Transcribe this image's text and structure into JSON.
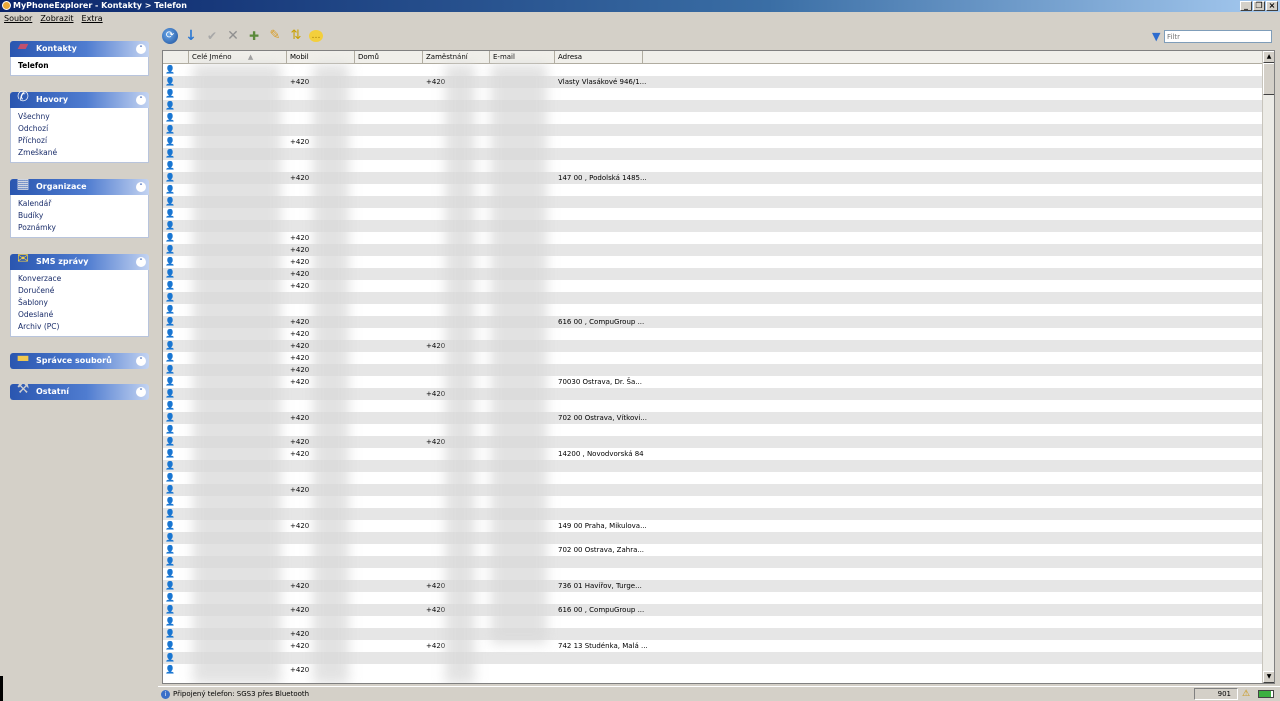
{
  "window": {
    "title": "MyPhoneExplorer -  Kontakty > Telefon",
    "buttons": [
      "_",
      "❐",
      "×"
    ]
  },
  "menu": [
    "Soubor",
    "Zobrazit",
    "Extra"
  ],
  "filter": {
    "placeholder": "Filtr"
  },
  "sidebar": {
    "groups": [
      {
        "title": "Kontakty",
        "icon": "contacts-book-icon",
        "items": [
          "Telefon"
        ]
      },
      {
        "title": "Hovory",
        "icon": "phone-calls-icon",
        "items": [
          "Všechny",
          "Odchozí",
          "Příchozí",
          "Zmeškané"
        ]
      },
      {
        "title": "Organizace",
        "icon": "organizer-icon",
        "items": [
          "Kalendář",
          "Budíky",
          "Poznámky"
        ]
      },
      {
        "title": "SMS zprávy",
        "icon": "sms-envelope-icon",
        "items": [
          "Konverzace",
          "Doručené",
          "Šablony",
          "Odeslané",
          "Archiv (PC)"
        ]
      },
      {
        "title": "Správce souborů",
        "icon": "folder-icon",
        "items": []
      },
      {
        "title": "Ostatní",
        "icon": "tools-icon",
        "items": []
      }
    ]
  },
  "grid": {
    "columns": [
      "Celé Jméno",
      "Mobil",
      "Domů",
      "Zaměstnání",
      "E-mail",
      "Adresa"
    ],
    "rows": [
      [
        "",
        "",
        "",
        "",
        "",
        ""
      ],
      [
        "",
        "+420",
        "",
        "+420",
        "",
        "Vlasty Vlasákové 946/1..."
      ],
      [
        "",
        "",
        "",
        "",
        "",
        ""
      ],
      [
        "",
        "",
        "",
        "",
        "",
        ""
      ],
      [
        "",
        "",
        "",
        "",
        "",
        ""
      ],
      [
        "",
        "",
        "",
        "",
        "",
        ""
      ],
      [
        "",
        "+420",
        "",
        "",
        "",
        ""
      ],
      [
        "",
        "",
        "",
        "",
        "",
        ""
      ],
      [
        "",
        "",
        "",
        "",
        "",
        ""
      ],
      [
        "",
        "+420",
        "",
        "",
        "",
        "147 00 , Podolská 1485..."
      ],
      [
        "",
        "",
        "",
        "",
        "",
        ""
      ],
      [
        "",
        "",
        "",
        "",
        "",
        ""
      ],
      [
        "",
        "",
        "",
        "",
        "",
        ""
      ],
      [
        "",
        "",
        "",
        "",
        "",
        ""
      ],
      [
        "",
        "+420",
        "",
        "",
        "",
        ""
      ],
      [
        "",
        "+420",
        "",
        "",
        "",
        ""
      ],
      [
        "",
        "+420",
        "",
        "",
        "",
        ""
      ],
      [
        "",
        "+420",
        "",
        "",
        "",
        ""
      ],
      [
        "",
        "+420",
        "",
        "",
        "",
        ""
      ],
      [
        "",
        "",
        "",
        "",
        "",
        ""
      ],
      [
        "",
        "",
        "",
        "",
        "",
        ""
      ],
      [
        "",
        "+420",
        "",
        "",
        "",
        "616 00 , CompuGroup ..."
      ],
      [
        "",
        "+420",
        "",
        "",
        "",
        ""
      ],
      [
        "",
        "+420",
        "",
        "+420",
        "",
        ""
      ],
      [
        "",
        "+420",
        "",
        "",
        "",
        ""
      ],
      [
        "",
        "+420",
        "",
        "",
        "",
        ""
      ],
      [
        "",
        "+420",
        "",
        "",
        "",
        "70030 Ostrava, Dr. Ša..."
      ],
      [
        "",
        "",
        "",
        "+420",
        "",
        ""
      ],
      [
        "",
        "",
        "",
        "",
        "",
        ""
      ],
      [
        "",
        "+420",
        "",
        "",
        "",
        "702 00 Ostrava, Vítkovi..."
      ],
      [
        "",
        "",
        "",
        "",
        "",
        ""
      ],
      [
        "",
        "+420",
        "",
        "+420",
        "",
        ""
      ],
      [
        "",
        "+420",
        "",
        "",
        "",
        "14200 , Novodvorská 84"
      ],
      [
        "",
        "",
        "",
        "",
        "",
        ""
      ],
      [
        "",
        "",
        "",
        "",
        "",
        ""
      ],
      [
        "",
        "+420",
        "",
        "",
        "",
        ""
      ],
      [
        "",
        "",
        "",
        "",
        "",
        ""
      ],
      [
        "",
        "",
        "",
        "",
        "",
        ""
      ],
      [
        "",
        "+420",
        "",
        "",
        "",
        "149 00 Praha, Mikulova..."
      ],
      [
        "",
        "",
        "",
        "",
        "",
        ""
      ],
      [
        "",
        "",
        "",
        "",
        "",
        "702 00 Ostrava, Zahra..."
      ],
      [
        "",
        "",
        "",
        "",
        "",
        ""
      ],
      [
        "",
        "",
        "",
        "",
        "",
        ""
      ],
      [
        "",
        "+420",
        "",
        "+420",
        "",
        "736 01 Havířov, Turge..."
      ],
      [
        "",
        "",
        "",
        "",
        "",
        ""
      ],
      [
        "",
        "+420",
        "",
        "+420",
        "",
        "616 00 , CompuGroup ..."
      ],
      [
        "",
        "",
        "",
        "",
        "",
        ""
      ],
      [
        "",
        "+420",
        "",
        "",
        "",
        ""
      ],
      [
        "",
        "+420",
        "",
        "+420",
        "",
        "742 13 Studénka, Malá ..."
      ],
      [
        "",
        "",
        "",
        "",
        "",
        ""
      ],
      [
        "",
        "+420",
        "",
        "",
        "",
        ""
      ]
    ]
  },
  "status": {
    "text": "Připojený telefon: SGS3 přes Bluetooth",
    "count": "901"
  }
}
